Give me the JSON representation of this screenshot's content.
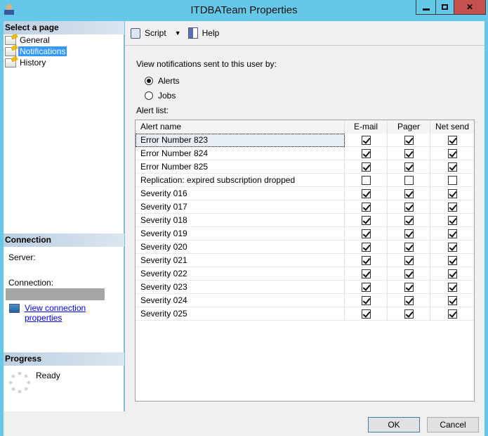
{
  "window": {
    "title": "ITDBATeam Properties"
  },
  "left": {
    "select_header": "Select a page",
    "pages": [
      {
        "label": "General",
        "selected": false
      },
      {
        "label": "Notifications",
        "selected": true
      },
      {
        "label": "History",
        "selected": false
      }
    ],
    "connection_header": "Connection",
    "server_label": "Server:",
    "connection_label": "Connection:",
    "view_conn_link": "View connection properties",
    "progress_header": "Progress",
    "progress_status": "Ready"
  },
  "toolbar": {
    "script": "Script",
    "help": "Help"
  },
  "main": {
    "notify_label": "View notifications sent to this user by:",
    "options": [
      {
        "label": "Alerts",
        "selected": true
      },
      {
        "label": "Jobs",
        "selected": false
      }
    ],
    "alert_list_label": "Alert list:",
    "columns": [
      "Alert name",
      "E-mail",
      "Pager",
      "Net send"
    ],
    "rows": [
      {
        "name": "Error Number 823",
        "email": true,
        "pager": true,
        "net": true
      },
      {
        "name": "Error Number 824",
        "email": true,
        "pager": true,
        "net": true
      },
      {
        "name": "Error Number 825",
        "email": true,
        "pager": true,
        "net": true
      },
      {
        "name": "Replication: expired subscription dropped",
        "email": false,
        "pager": false,
        "net": false
      },
      {
        "name": "Severity 016",
        "email": true,
        "pager": true,
        "net": true
      },
      {
        "name": "Severity 017",
        "email": true,
        "pager": true,
        "net": true
      },
      {
        "name": "Severity 018",
        "email": true,
        "pager": true,
        "net": true
      },
      {
        "name": "Severity 019",
        "email": true,
        "pager": true,
        "net": true
      },
      {
        "name": "Severity 020",
        "email": true,
        "pager": true,
        "net": true
      },
      {
        "name": "Severity 021",
        "email": true,
        "pager": true,
        "net": true
      },
      {
        "name": "Severity 022",
        "email": true,
        "pager": true,
        "net": true
      },
      {
        "name": "Severity 023",
        "email": true,
        "pager": true,
        "net": true
      },
      {
        "name": "Severity 024",
        "email": true,
        "pager": true,
        "net": true
      },
      {
        "name": "Severity 025",
        "email": true,
        "pager": true,
        "net": true
      }
    ]
  },
  "buttons": {
    "ok": "OK",
    "cancel": "Cancel"
  }
}
